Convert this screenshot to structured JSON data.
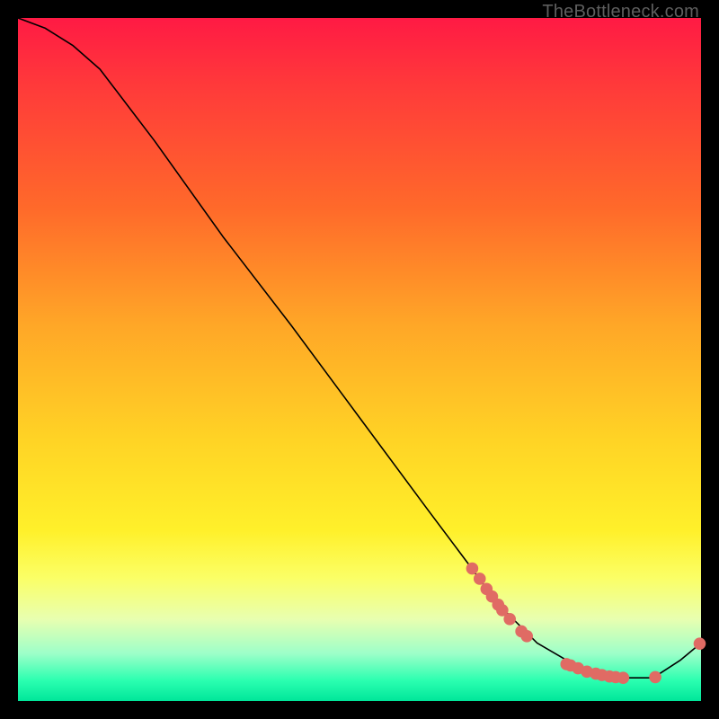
{
  "attribution": "TheBottleneck.com",
  "colors": {
    "dot": "#e06b64",
    "curve": "#000000"
  },
  "chart_data": {
    "type": "line",
    "title": "",
    "xlabel": "",
    "ylabel": "",
    "xlim": [
      0,
      100
    ],
    "ylim": [
      0,
      100
    ],
    "grid": false,
    "series": [
      {
        "name": "curve",
        "x": [
          0,
          4,
          8,
          12,
          20,
          30,
          40,
          50,
          60,
          66,
          70,
          76,
          82,
          88,
          93,
          97,
          100
        ],
        "y": [
          100,
          98.5,
          96,
          92.5,
          82,
          68,
          55,
          41.5,
          28,
          20,
          14.5,
          8.5,
          5,
          3.4,
          3.4,
          6,
          8.5
        ]
      }
    ],
    "markers": [
      {
        "x": 66.5,
        "y": 19.4
      },
      {
        "x": 67.6,
        "y": 17.9
      },
      {
        "x": 68.6,
        "y": 16.4
      },
      {
        "x": 69.4,
        "y": 15.3
      },
      {
        "x": 70.3,
        "y": 14.1
      },
      {
        "x": 70.9,
        "y": 13.3
      },
      {
        "x": 72.0,
        "y": 12.0
      },
      {
        "x": 73.7,
        "y": 10.2
      },
      {
        "x": 74.5,
        "y": 9.5
      },
      {
        "x": 80.3,
        "y": 5.4
      },
      {
        "x": 80.9,
        "y": 5.2
      },
      {
        "x": 82.0,
        "y": 4.8
      },
      {
        "x": 83.3,
        "y": 4.3
      },
      {
        "x": 84.6,
        "y": 4.0
      },
      {
        "x": 85.5,
        "y": 3.8
      },
      {
        "x": 86.6,
        "y": 3.6
      },
      {
        "x": 87.5,
        "y": 3.5
      },
      {
        "x": 88.6,
        "y": 3.4
      },
      {
        "x": 93.3,
        "y": 3.5
      },
      {
        "x": 99.8,
        "y": 8.4
      }
    ]
  }
}
